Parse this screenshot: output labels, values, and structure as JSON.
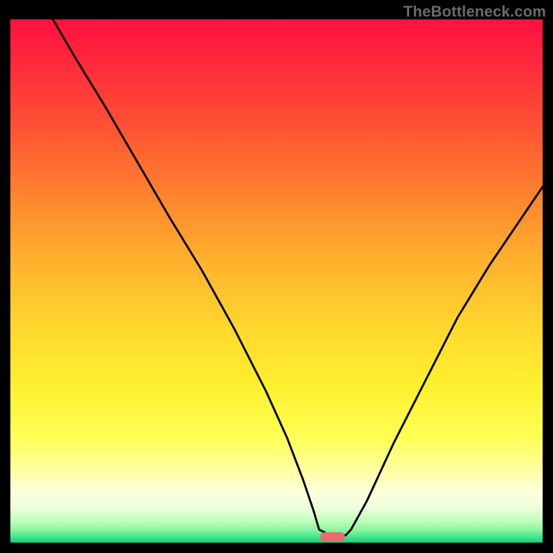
{
  "watermark": "TheBottleneck.com",
  "gradient_stops": [
    {
      "offset": 0.0,
      "color": "#ff103f"
    },
    {
      "offset": 0.1,
      "color": "#ff2f3a"
    },
    {
      "offset": 0.2,
      "color": "#ff5034"
    },
    {
      "offset": 0.32,
      "color": "#ff7d2f"
    },
    {
      "offset": 0.45,
      "color": "#ffad2e"
    },
    {
      "offset": 0.58,
      "color": "#ffd52e"
    },
    {
      "offset": 0.7,
      "color": "#fff02f"
    },
    {
      "offset": 0.8,
      "color": "#ffff55"
    },
    {
      "offset": 0.86,
      "color": "#ffffa0"
    },
    {
      "offset": 0.9,
      "color": "#ffffd8"
    },
    {
      "offset": 0.93,
      "color": "#f0ffe0"
    },
    {
      "offset": 0.955,
      "color": "#c8ffc0"
    },
    {
      "offset": 0.975,
      "color": "#8ff5a0"
    },
    {
      "offset": 0.99,
      "color": "#3ee58a"
    },
    {
      "offset": 1.0,
      "color": "#19c976"
    }
  ],
  "chart_data": {
    "type": "line",
    "title": "",
    "xlabel": "",
    "ylabel": "",
    "xlim": [
      0,
      100
    ],
    "ylim": [
      0,
      100
    ],
    "grid": false,
    "series": [
      {
        "name": "bottleneck-curve",
        "x": [
          8,
          12,
          18,
          24,
          26,
          30,
          36,
          42,
          48,
          52,
          55,
          57,
          58,
          60.5,
          63,
          64,
          67,
          72,
          78,
          84,
          90,
          96,
          100
        ],
        "y": [
          100,
          93,
          83,
          72.5,
          69,
          62,
          52,
          41,
          29,
          20,
          12,
          6,
          2.5,
          1.2,
          1.4,
          2.5,
          8,
          19,
          31,
          43,
          53,
          62,
          68
        ]
      }
    ],
    "annotations": [
      {
        "name": "optimal-marker",
        "x": 60.5,
        "y": 1.0,
        "shape": "pill",
        "color": "#e36f6f"
      }
    ]
  }
}
